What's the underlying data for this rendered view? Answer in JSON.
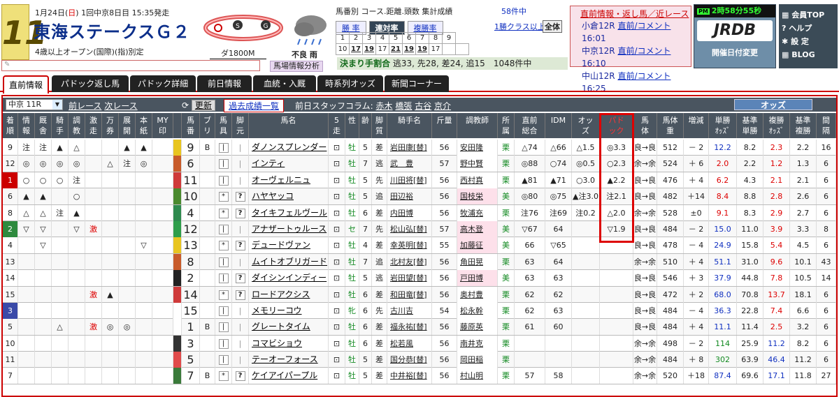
{
  "race": {
    "number": "11",
    "date_prefix": "1月24日(",
    "date_day": "日",
    "date_suffix": ") 1回中京8日目 15:35発走",
    "name": "東海ステークスＧ２",
    "conditions": "4歳以上オープン(国際)(指)別定",
    "distance": "ダ1800M",
    "weather": "不良 雨"
  },
  "babainfo": "馬場情報分析",
  "stats": {
    "title": "馬番別 コース.距離.頭数 集計成績",
    "count": "58件中",
    "tab_win": "勝 率",
    "tab_rentai": "連対率",
    "tab_fukusho": "複勝率",
    "link": "1勝クラス以上",
    "all": "全体",
    "row1": [
      "1",
      "2",
      "3",
      "4",
      "5",
      "6",
      "7",
      "8",
      "9"
    ],
    "row2": [
      "10",
      "17",
      "19",
      "17",
      "21",
      "19",
      "19",
      "17",
      "",
      ""
    ],
    "row2_u": [
      false,
      true,
      true,
      false,
      true,
      true,
      true,
      false,
      false,
      false
    ]
  },
  "kimari": {
    "label": "決まり手割合",
    "text": "逃33, 先28, 差24, 追15",
    "count": "1048件中"
  },
  "chokuzen": {
    "heading": "直前情報・返し馬／近レース",
    "races": [
      {
        "name": "小倉12R",
        "link": "直前/コメント",
        "time": "16:01"
      },
      {
        "name": "中京12R",
        "link": "直前/コメント",
        "time": "16:10"
      },
      {
        "name": "中山12R",
        "link": "直前/コメント",
        "time": "16:25"
      }
    ]
  },
  "jrdb": {
    "pm": "PM",
    "clock": "2時58分55秒",
    "logo": "JRDB",
    "kaisai": "開催日付変更"
  },
  "menu": [
    "会員TOP",
    "ヘルプ",
    "設 定",
    "BLOG"
  ],
  "tabs": [
    "直前情報",
    "パドック返し馬",
    "パドック詳細",
    "前日情報",
    "血統・入厩",
    "時系列オッズ",
    "新聞コーナー"
  ],
  "controls": {
    "race_select": "中京 11R",
    "prev": "前レース",
    "next": "次レース",
    "update": "更新",
    "past": "過去成績一覧",
    "column_label": "前日スタッフコラム:",
    "columnists": [
      "赤木",
      "橋張",
      "古谷",
      "京介"
    ],
    "odds": "オッズ"
  },
  "headers": [
    "着\n順",
    "情\n報",
    "厩\n舎",
    "騎\n手",
    "調\n教",
    "激\n走",
    "万\n券",
    "展\n開",
    "本\n紙",
    "MY\n印",
    "",
    "馬\n番",
    "ブ\nリ",
    "馬\n具",
    "脚\n元",
    "馬名",
    "5\n走",
    "性",
    "齢",
    "脚\n質",
    "騎手名",
    "斤量",
    "調教師",
    "所\n属",
    "直前\n総合",
    "IDM",
    "オッ\nズ",
    "パド\nック",
    "馬\n体",
    "馬体\n重",
    "増減",
    "単勝\nｵｯｽﾞ",
    "基準\n単勝",
    "複勝\nｵｯｽﾞ",
    "基準\n複勝",
    "間\n隔"
  ],
  "rows": [
    {
      "chaku": "9",
      "marks": [
        "注",
        "注",
        "▲",
        "△",
        "",
        "",
        "▲",
        "▲"
      ],
      "gate": "#e8c520",
      "ban": "9",
      "buri": "B",
      "gu": "",
      "ashi": "",
      "name": "ダノンスプレンダー",
      "sex": "牡",
      "age": "5",
      "kyaku": "差",
      "jockey": "岩田康[替]",
      "kin": "56",
      "trainer": "安田隆",
      "zoku": "栗",
      "cho": "△74",
      "idm": "△66",
      "odds": "△1.5",
      "pad": "◎3.3",
      "tai": "良→良",
      "weight": "512",
      "zougen": "－ 2",
      "tan": "12.2",
      "ktan": "8.2",
      "fuku": "2.3",
      "kfuku": "2.2",
      "kankaku": "16",
      "tanc": "blue",
      "fukuc": "red"
    },
    {
      "chaku": "12",
      "marks": [
        "◎",
        "◎",
        "◎",
        "◎",
        "",
        "△",
        "注",
        "◎"
      ],
      "gate": "#c85b2a",
      "ban": "6",
      "buri": "",
      "gu": "",
      "ashi": "",
      "name": "インティ",
      "sex": "牡",
      "age": "7",
      "kyaku": "逃",
      "jockey": "武　豊",
      "kin": "57",
      "trainer": "野中賢",
      "zoku": "栗",
      "cho": "◎88",
      "idm": "○74",
      "odds": "◎0.5",
      "pad": "○2.3",
      "tai": "余→余",
      "weight": "524",
      "zougen": "＋ 6",
      "tan": "2.0",
      "ktan": "2.2",
      "fuku": "1.2",
      "kfuku": "1.3",
      "kankaku": "6",
      "tanc": "red",
      "fukuc": "red"
    },
    {
      "chaku": "1",
      "marks": [
        "○",
        "○",
        "○",
        "注",
        "",
        "",
        "",
        ""
      ],
      "gate": "#cf3a3a",
      "ban": "11",
      "buri": "",
      "gu": "",
      "ashi": "",
      "name": "オーヴェルニュ",
      "sex": "牡",
      "age": "5",
      "kyaku": "先",
      "jockey": "川田将[替]",
      "kin": "56",
      "trainer": "西村真",
      "zoku": "栗",
      "cho": "▲81",
      "idm": "▲71",
      "odds": "○3.0",
      "pad": "▲2.2",
      "tai": "良→良",
      "weight": "476",
      "zougen": "＋ 4",
      "tan": "6.2",
      "ktan": "4.3",
      "fuku": "2.1",
      "kfuku": "2.1",
      "kankaku": "6",
      "tanc": "red",
      "fukuc": "red",
      "chakucolor": "#c00"
    },
    {
      "chaku": "6",
      "marks": [
        "▲",
        "▲",
        "",
        "○",
        "",
        "",
        "",
        ""
      ],
      "gate": "#4a8a2e",
      "ban": "10",
      "buri": "",
      "gu": "*",
      "ashi": "?",
      "name": "ハヤヤッコ",
      "sex": "牡",
      "age": "5",
      "kyaku": "追",
      "jockey": "田辺裕",
      "kin": "56",
      "trainer": "国枝栄",
      "zoku": "美",
      "cho": "◎80",
      "idm": "◎75",
      "odds": "▲注3.0",
      "pad": "注2.1",
      "tai": "良→良",
      "weight": "482",
      "zougen": "＋14",
      "tan": "8.4",
      "ktan": "8.8",
      "fuku": "2.8",
      "kfuku": "2.6",
      "kankaku": "6",
      "tanc": "red",
      "fukuc": "red"
    },
    {
      "chaku": "8",
      "marks": [
        "△",
        "△",
        "注",
        "▲",
        "",
        "",
        "",
        ""
      ],
      "gate": "#2e8a4e",
      "ban": "4",
      "buri": "",
      "gu": "*",
      "ashi": "?",
      "name": "タイキフェルヴール",
      "sex": "牡",
      "age": "6",
      "kyaku": "差",
      "jockey": "内田博",
      "kin": "56",
      "trainer": "牧浦充",
      "zoku": "栗",
      "cho": "注76",
      "idm": "注69",
      "odds": "注0.2",
      "pad": "△2.0",
      "tai": "余→余",
      "weight": "528",
      "zougen": "±0",
      "tan": "9.1",
      "ktan": "8.3",
      "fuku": "2.9",
      "kfuku": "2.7",
      "kankaku": "6",
      "tanc": "red",
      "fukuc": "red"
    },
    {
      "chaku": "2",
      "marks": [
        "▽",
        "▽",
        "",
        "▽",
        "激",
        "",
        "",
        ""
      ],
      "gate": "#2e9e4a",
      "ban": "12",
      "buri": "",
      "gu": "",
      "ashi": "",
      "name": "アナザートゥルース",
      "sex": "セ",
      "age": "7",
      "kyaku": "先",
      "jockey": "松山弘[替]",
      "kin": "57",
      "trainer": "高木登",
      "zoku": "美",
      "cho": "▽67",
      "idm": "64",
      "odds": "",
      "pad": "▽1.9",
      "tai": "良→良",
      "weight": "484",
      "zougen": "－ 2",
      "tan": "15.0",
      "ktan": "11.0",
      "fuku": "3.9",
      "kfuku": "3.3",
      "kankaku": "8",
      "tanc": "blue",
      "fukuc": "red",
      "chakucolor": "#2e8a3e"
    },
    {
      "chaku": "4",
      "marks": [
        "",
        "▽",
        "",
        "",
        "",
        "",
        "",
        "▽"
      ],
      "gate": "#e8c520",
      "ban": "13",
      "buri": "",
      "gu": "*",
      "ashi": "?",
      "name": "デュードヴァン",
      "sex": "牡",
      "age": "4",
      "kyaku": "差",
      "jockey": "幸英明[替]",
      "kin": "55",
      "trainer": "加藤征",
      "zoku": "美",
      "cho": "66",
      "idm": "▽65",
      "odds": "",
      "pad": "",
      "tai": "良→良",
      "weight": "478",
      "zougen": "－ 4",
      "tan": "24.9",
      "ktan": "15.8",
      "fuku": "5.4",
      "kfuku": "4.5",
      "kankaku": "6",
      "tanc": "blue",
      "fukuc": "red"
    },
    {
      "chaku": "13",
      "marks": [
        "",
        "",
        "",
        "",
        "",
        "",
        "",
        ""
      ],
      "gate": "#c85b2a",
      "ban": "8",
      "buri": "",
      "gu": "",
      "ashi": "",
      "name": "ムイトオブリガード",
      "sex": "牡",
      "age": "7",
      "kyaku": "追",
      "jockey": "北村友[替]",
      "kin": "56",
      "trainer": "角田晃",
      "zoku": "栗",
      "cho": "63",
      "idm": "64",
      "odds": "",
      "pad": "",
      "tai": "余→余",
      "weight": "510",
      "zougen": "＋ 4",
      "tan": "51.1",
      "ktan": "31.0",
      "fuku": "9.6",
      "kfuku": "10.1",
      "kankaku": "43",
      "tanc": "blue",
      "fukuc": "red"
    },
    {
      "chaku": "14",
      "marks": [
        "",
        "",
        "",
        "",
        "",
        "",
        "",
        ""
      ],
      "gate": "#222",
      "ban": "2",
      "buri": "",
      "gu": "",
      "ashi": "?",
      "name": "ダイシンインディー",
      "sex": "牡",
      "age": "5",
      "kyaku": "逃",
      "jockey": "岩田望[替]",
      "kin": "56",
      "trainer": "戸田博",
      "zoku": "美",
      "cho": "63",
      "idm": "63",
      "odds": "",
      "pad": "",
      "tai": "良→良",
      "weight": "546",
      "zougen": "＋ 3",
      "tan": "37.9",
      "ktan": "44.8",
      "fuku": "7.8",
      "kfuku": "10.5",
      "kankaku": "14",
      "tanc": "blue",
      "fukuc": "red"
    },
    {
      "chaku": "15",
      "marks": [
        "",
        "",
        "",
        "",
        "激",
        "▲",
        "",
        ""
      ],
      "gate": "#cf3a3a",
      "ban": "14",
      "buri": "",
      "gu": "*",
      "ashi": "?",
      "name": "ロードアクシス",
      "sex": "牡",
      "age": "6",
      "kyaku": "差",
      "jockey": "和田竜[替]",
      "kin": "56",
      "trainer": "奥村豊",
      "zoku": "栗",
      "cho": "62",
      "idm": "62",
      "odds": "",
      "pad": "",
      "tai": "良→良",
      "weight": "472",
      "zougen": "＋ 2",
      "tan": "68.0",
      "ktan": "70.8",
      "fuku": "13.7",
      "kfuku": "18.1",
      "kankaku": "6",
      "tanc": "blue",
      "fukuc": "red"
    },
    {
      "chaku": "3",
      "marks": [
        "",
        "",
        "",
        "",
        "",
        "",
        "",
        ""
      ],
      "gate": "#fff",
      "ban": "15",
      "buri": "",
      "gu": "",
      "ashi": "",
      "name": "メモリーコウ",
      "sex": "牝",
      "age": "6",
      "kyaku": "先",
      "jockey": "古川吉",
      "kin": "54",
      "trainer": "松永幹",
      "zoku": "栗",
      "cho": "62",
      "idm": "63",
      "odds": "",
      "pad": "",
      "tai": "良→良",
      "weight": "484",
      "zougen": "－ 4",
      "tan": "36.3",
      "ktan": "22.8",
      "fuku": "7.4",
      "kfuku": "6.6",
      "kankaku": "6",
      "tanc": "blue",
      "fukuc": "red",
      "chakucolor": "#3a4aa8"
    },
    {
      "chaku": "5",
      "marks": [
        "",
        "",
        "△",
        "",
        "激",
        "◎",
        "◎",
        ""
      ],
      "gate": "#fff",
      "ban": "1",
      "buri": "B",
      "gu": "",
      "ashi": "",
      "name": "グレートタイム",
      "sex": "牡",
      "age": "6",
      "kyaku": "差",
      "jockey": "福永祐[替]",
      "kin": "56",
      "trainer": "藤原英",
      "zoku": "栗",
      "cho": "61",
      "idm": "60",
      "odds": "",
      "pad": "",
      "tai": "良→良",
      "weight": "484",
      "zougen": "＋ 4",
      "tan": "11.1",
      "ktan": "11.4",
      "fuku": "2.5",
      "kfuku": "3.2",
      "kankaku": "6",
      "tanc": "blue",
      "fukuc": "red"
    },
    {
      "chaku": "10",
      "marks": [
        "",
        "",
        "",
        "",
        "",
        "",
        "",
        ""
      ],
      "gate": "#333",
      "ban": "3",
      "buri": "",
      "gu": "",
      "ashi": "",
      "name": "コマビショウ",
      "sex": "牡",
      "age": "6",
      "kyaku": "差",
      "jockey": "松若風",
      "kin": "56",
      "trainer": "南井克",
      "zoku": "栗",
      "cho": "",
      "idm": "",
      "odds": "",
      "pad": "",
      "tai": "余→余",
      "weight": "498",
      "zougen": "－ 2",
      "tan": "114",
      "ktan": "25.9",
      "fuku": "11.2",
      "kfuku": "8.2",
      "kankaku": "6",
      "tanc": "grn",
      "fukuc": "blue"
    },
    {
      "chaku": "11",
      "marks": [
        "",
        "",
        "",
        "",
        "",
        "",
        "",
        ""
      ],
      "gate": "#e04a4a",
      "ban": "5",
      "buri": "",
      "gu": "",
      "ashi": "",
      "name": "テーオーフォース",
      "sex": "牡",
      "age": "5",
      "kyaku": "差",
      "jockey": "国分恭[替]",
      "kin": "56",
      "trainer": "岡田稲",
      "zoku": "栗",
      "cho": "",
      "idm": "",
      "odds": "",
      "pad": "",
      "tai": "余→余",
      "weight": "484",
      "zougen": "＋ 8",
      "tan": "302",
      "ktan": "63.9",
      "fuku": "46.4",
      "kfuku": "11.2",
      "kankaku": "6",
      "tanc": "grn",
      "fukuc": "blue"
    },
    {
      "chaku": "7",
      "marks": [
        "",
        "",
        "",
        "",
        "",
        "",
        "",
        ""
      ],
      "gate": "#3a7a3a",
      "ban": "7",
      "buri": "B",
      "gu": "*",
      "ashi": "?",
      "name": "ケイアイパープル",
      "sex": "牡",
      "age": "5",
      "kyaku": "差",
      "jockey": "中井裕[替]",
      "kin": "56",
      "trainer": "村山明",
      "zoku": "栗",
      "cho": "57",
      "idm": "58",
      "odds": "",
      "pad": "",
      "tai": "余→余",
      "weight": "520",
      "zougen": "＋18",
      "tan": "87.4",
      "ktan": "69.6",
      "fuku": "17.1",
      "kfuku": "11.8",
      "kankaku": "27",
      "tanc": "blue",
      "fukuc": "blue"
    }
  ]
}
